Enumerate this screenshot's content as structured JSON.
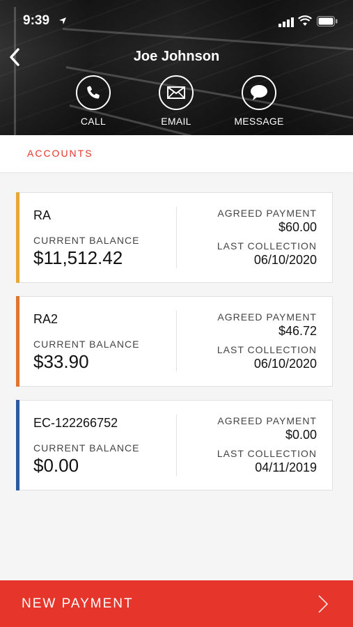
{
  "status_bar": {
    "time": "9:39"
  },
  "header": {
    "contact_name": "Joe Johnson",
    "actions": [
      {
        "label": "CALL",
        "icon": "phone-icon"
      },
      {
        "label": "EMAIL",
        "icon": "envelope-icon"
      },
      {
        "label": "MESSAGE",
        "icon": "chat-bubble-icon"
      }
    ]
  },
  "tabs": {
    "accounts_label": "ACCOUNTS"
  },
  "colors": {
    "accent": "#e6352b",
    "stripe_ra": "#e8a838",
    "stripe_ra2": "#e0752e",
    "stripe_ec": "#2c5aa0"
  },
  "accounts": [
    {
      "id": "RA",
      "balance_label": "CURRENT BALANCE",
      "balance": "$11,512.42",
      "agreed_label": "AGREED PAYMENT",
      "agreed": "$60.00",
      "last_label": "LAST COLLECTION",
      "last": "06/10/2020"
    },
    {
      "id": "RA2",
      "balance_label": "CURRENT BALANCE",
      "balance": "$33.90",
      "agreed_label": "AGREED PAYMENT",
      "agreed": "$46.72",
      "last_label": "LAST COLLECTION",
      "last": "06/10/2020"
    },
    {
      "id": "EC-122266752",
      "balance_label": "CURRENT BALANCE",
      "balance": "$0.00",
      "agreed_label": "AGREED PAYMENT",
      "agreed": "$0.00",
      "last_label": "LAST COLLECTION",
      "last": "04/11/2019"
    }
  ],
  "footer": {
    "new_payment_label": "NEW PAYMENT"
  }
}
